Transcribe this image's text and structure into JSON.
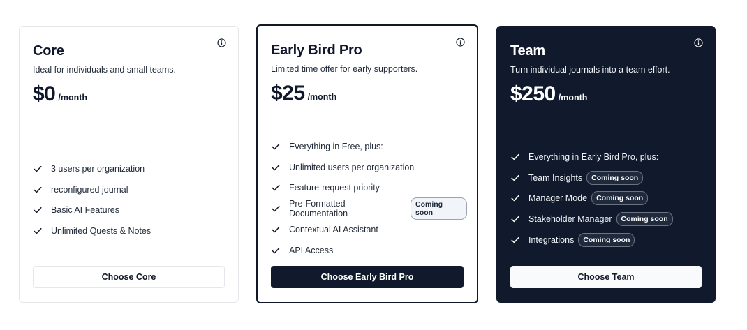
{
  "plans": [
    {
      "title": "Core",
      "description": "Ideal for individuals and small teams.",
      "price": "$0",
      "period": "/month",
      "features": [
        {
          "text": "3 users per organization",
          "badge": ""
        },
        {
          "text": "reconfigured journal",
          "badge": ""
        },
        {
          "text": "Basic AI Features",
          "badge": ""
        },
        {
          "text": "Unlimited Quests & Notes",
          "badge": ""
        }
      ],
      "cta": "Choose Core"
    },
    {
      "title": "Early Bird Pro",
      "description": "Limited time offer for early supporters.",
      "price": "$25",
      "period": "/month",
      "features": [
        {
          "text": "Everything in Free, plus:",
          "badge": ""
        },
        {
          "text": "Unlimited users per organization",
          "badge": ""
        },
        {
          "text": "Feature-request priority",
          "badge": ""
        },
        {
          "text": "Pre-Formatted Documentation",
          "badge": "Coming soon"
        },
        {
          "text": "Contextual AI Assistant",
          "badge": ""
        },
        {
          "text": "API Access",
          "badge": ""
        }
      ],
      "cta": "Choose Early Bird Pro"
    },
    {
      "title": "Team",
      "description": "Turn individual journals into a team effort.",
      "price": "$250",
      "period": "/month",
      "features": [
        {
          "text": "Everything in Early Bird Pro, plus:",
          "badge": ""
        },
        {
          "text": "Team Insights",
          "badge": "Coming soon"
        },
        {
          "text": "Manager Mode",
          "badge": "Coming soon"
        },
        {
          "text": "Stakeholder Manager",
          "badge": "Coming soon"
        },
        {
          "text": "Integrations",
          "badge": "Coming soon"
        }
      ],
      "cta": "Choose Team"
    }
  ],
  "colors": {
    "dark_card": "#111a2c",
    "border_light": "#e5e7eb",
    "text_dark": "#0f172a"
  },
  "icons": {
    "info": "info-circle-icon",
    "check": "check-icon"
  }
}
